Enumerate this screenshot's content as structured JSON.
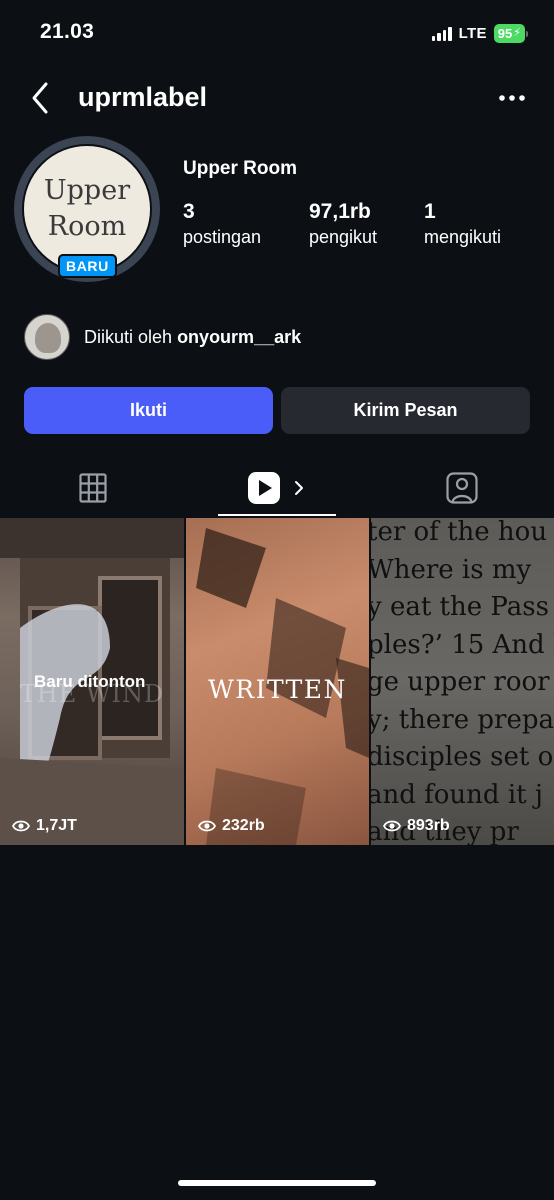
{
  "status_bar": {
    "time": "21.03",
    "network": "LTE",
    "battery": "95"
  },
  "header": {
    "username": "uprmlabel"
  },
  "profile": {
    "avatar_text_line1": "Upper",
    "avatar_text_line2": "Room",
    "badge": "BARU",
    "display_name": "Upper Room",
    "stats": {
      "posts": {
        "value": "3",
        "label": "postingan"
      },
      "followers": {
        "value": "97,1rb",
        "label": "pengikut"
      },
      "following": {
        "value": "1",
        "label": "mengikuti"
      }
    }
  },
  "followed_by": {
    "prefix": "Diikuti oleh",
    "account": "onyourm__ark"
  },
  "actions": {
    "follow": "Ikuti",
    "message": "Kirim Pesan"
  },
  "tabs": [
    "grid-icon",
    "reels-icon",
    "tagged-icon"
  ],
  "grid": [
    {
      "overlay": "Baru ditonton",
      "bg_text": "THE WIND",
      "views": "1,7JT"
    },
    {
      "bg_text": "WRITTEN",
      "views": "232rb"
    },
    {
      "bg_text_lines": [
        "ter of the hou",
        "Where is my",
        "y eat the Pass",
        "ples?’ 15 And h",
        "ge upper roor",
        "y; there prepa",
        "disciples set o",
        "and found it j",
        "and they pr"
      ],
      "views": "893rb"
    }
  ],
  "colors": {
    "background": "#0c1014",
    "follow_button": "#4a5df9",
    "message_button": "#262a30",
    "badge": "#0095f6"
  }
}
